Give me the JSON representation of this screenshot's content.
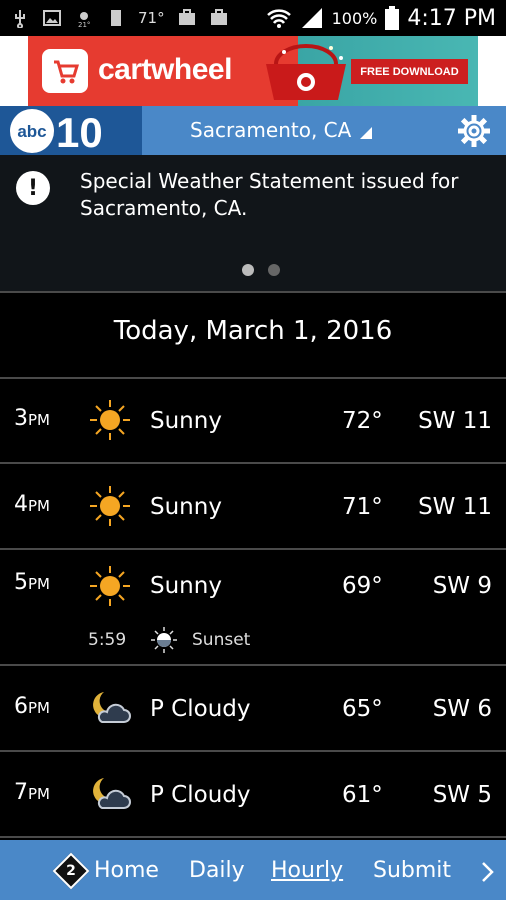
{
  "status_bar": {
    "left_temp": "71°",
    "battery_pct": "100%",
    "time": "4:17 PM"
  },
  "ad": {
    "brand": "cartwheel",
    "button": "FREE DOWNLOAD"
  },
  "header": {
    "location": "Sacramento, CA"
  },
  "alert": {
    "text": "Special Weather Statement issued for Sacramento, CA."
  },
  "date_label": "Today, March 1, 2016",
  "hours": [
    {
      "hour": "3",
      "ampm": "PM",
      "icon": "sun-icon",
      "condition": "Sunny",
      "temp": "72°",
      "wind": "SW 11"
    },
    {
      "hour": "4",
      "ampm": "PM",
      "icon": "sun-icon",
      "condition": "Sunny",
      "temp": "71°",
      "wind": "SW 11"
    },
    {
      "hour": "5",
      "ampm": "PM",
      "icon": "sun-icon",
      "condition": "Sunny",
      "temp": "69°",
      "wind": "SW 9"
    },
    {
      "hour": "6",
      "ampm": "PM",
      "icon": "moon-cloud-icon",
      "condition": "P Cloudy",
      "temp": "65°",
      "wind": "SW 6"
    },
    {
      "hour": "7",
      "ampm": "PM",
      "icon": "moon-cloud-icon",
      "condition": "P Cloudy",
      "temp": "61°",
      "wind": "SW 5"
    }
  ],
  "sunset": {
    "time": "5:59",
    "label": "Sunset"
  },
  "nav": {
    "badge": "2",
    "home": "Home",
    "daily": "Daily",
    "hourly": "Hourly",
    "submit": "Submit"
  },
  "colors": {
    "header_blue": "#4a88c8",
    "logo_blue": "#1e5797",
    "sun": "#f5a623"
  }
}
